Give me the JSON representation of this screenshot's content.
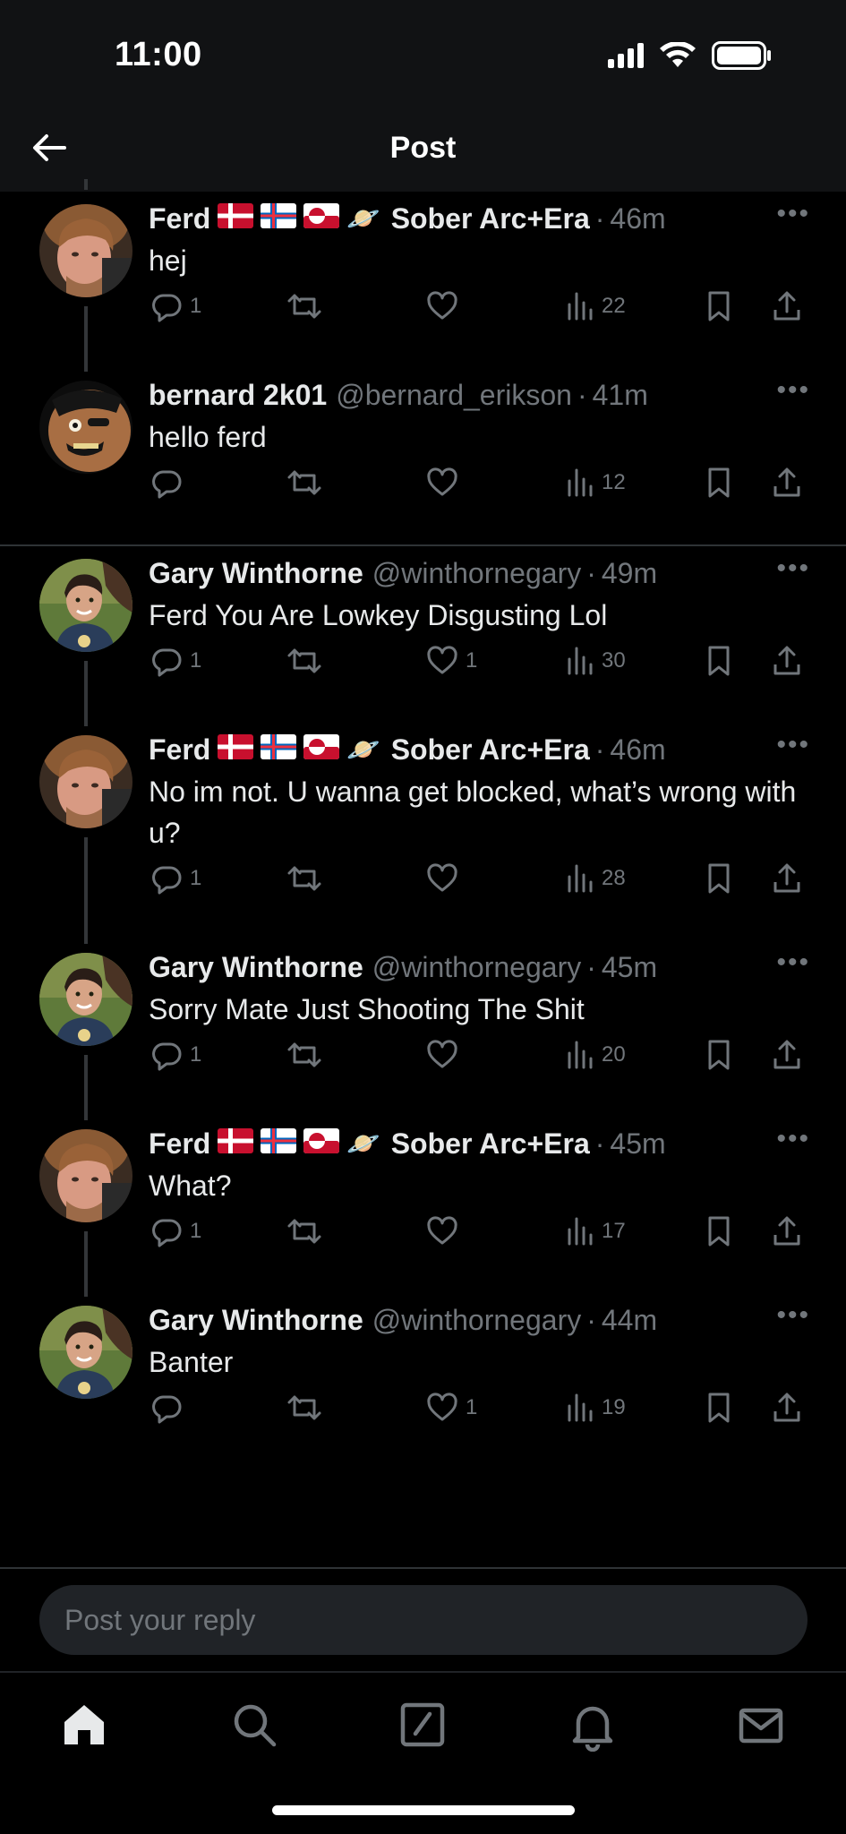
{
  "status_bar": {
    "time": "11:00"
  },
  "header": {
    "title": "Post"
  },
  "tweets": [
    {
      "name": "Ferd",
      "flags": [
        "denmark",
        "faroe-islands",
        "greenland"
      ],
      "emoji": "🪐",
      "name_suffix": "Sober Arc+Era",
      "handle": "",
      "time": "46m",
      "text": "hej",
      "replies": "1",
      "retweets": "",
      "likes": "",
      "views": "22"
    },
    {
      "name": "bernard 2k01",
      "flags": [],
      "emoji": "",
      "name_suffix": "",
      "handle": "@bernard_erikson",
      "time": "41m",
      "text": "hello ferd",
      "replies": "",
      "retweets": "",
      "likes": "",
      "views": "12"
    },
    {
      "name": "Gary Winthorne",
      "flags": [],
      "emoji": "",
      "name_suffix": "",
      "handle": "@winthornegary",
      "time": "49m",
      "text": "Ferd You Are Lowkey Disgusting Lol",
      "replies": "1",
      "retweets": "",
      "likes": "1",
      "views": "30"
    },
    {
      "name": "Ferd",
      "flags": [
        "denmark",
        "faroe-islands",
        "greenland"
      ],
      "emoji": "🪐",
      "name_suffix": "Sober Arc+Era",
      "handle": "",
      "time": "46m",
      "text": "No im not. U wanna get blocked, what’s wrong with u?",
      "replies": "1",
      "retweets": "",
      "likes": "",
      "views": "28"
    },
    {
      "name": "Gary Winthorne",
      "flags": [],
      "emoji": "",
      "name_suffix": "",
      "handle": "@winthornegary",
      "time": "45m",
      "text": "Sorry Mate Just Shooting The Shit",
      "replies": "1",
      "retweets": "",
      "likes": "",
      "views": "20"
    },
    {
      "name": "Ferd",
      "flags": [
        "denmark",
        "faroe-islands",
        "greenland"
      ],
      "emoji": "🪐",
      "name_suffix": "Sober Arc+Era",
      "handle": "",
      "time": "45m",
      "text": "What?",
      "replies": "1",
      "retweets": "",
      "likes": "",
      "views": "17"
    },
    {
      "name": "Gary Winthorne",
      "flags": [],
      "emoji": "",
      "name_suffix": "",
      "handle": "@winthornegary",
      "time": "44m",
      "text": "Banter",
      "replies": "",
      "retweets": "",
      "likes": "1",
      "views": "19"
    }
  ],
  "reply": {
    "placeholder": "Post your reply"
  },
  "tabbar": {
    "items": [
      "home-icon",
      "search-icon",
      "compose-icon",
      "notifications-icon",
      "messages-icon"
    ]
  },
  "colors": {
    "background": "#000000",
    "text": "#e7e9ea",
    "muted": "#71767b",
    "divider": "#2f3336",
    "input": "#202327"
  }
}
